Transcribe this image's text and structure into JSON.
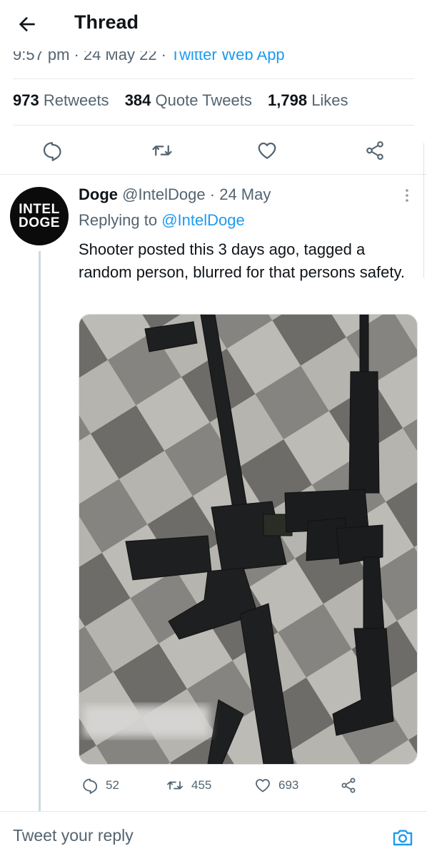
{
  "header": {
    "title": "Thread",
    "back_icon": "arrow-left-icon"
  },
  "meta": {
    "time": "9:57 pm",
    "date": "24 May 22",
    "app": "Twitter Web App"
  },
  "counts": [
    {
      "value": "973",
      "label": "Retweets"
    },
    {
      "value": "384",
      "label": "Quote Tweets"
    },
    {
      "value": "1,798",
      "label": "Likes"
    }
  ],
  "actions": [
    "reply-icon",
    "retweet-icon",
    "like-icon",
    "share-icon"
  ],
  "reply_tweet": {
    "avatar": {
      "line1": "INTEL",
      "line2": "DOGE"
    },
    "name": "Doge",
    "handle": "@IntelDoge",
    "date": "24 May",
    "replying_prefix": "Replying to",
    "replying_to": "@IntelDoge",
    "text": "Shooter posted this 3 days ago, tagged a random person, blurred for that persons safety.",
    "stats": {
      "replies": "52",
      "retweets": "455",
      "likes": "693"
    }
  },
  "compose": {
    "placeholder": "Tweet your reply"
  },
  "colors": {
    "accent": "#1d9bf0",
    "muted": "#536471",
    "text": "#0f1419",
    "divider": "#e5e9ec"
  }
}
